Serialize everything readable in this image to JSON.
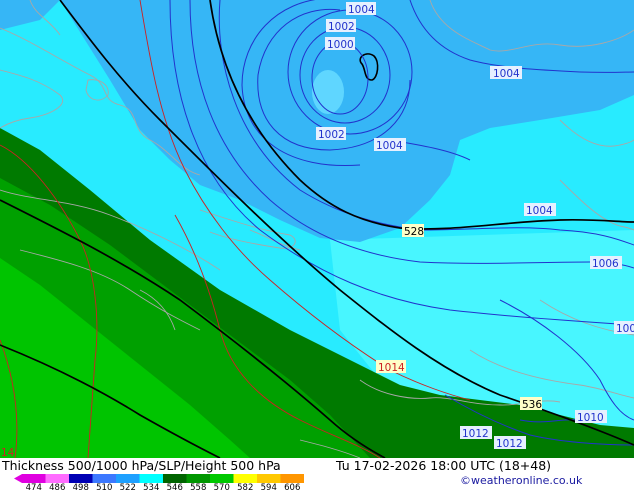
{
  "footer": {
    "title": "Thickness 500/1000 hPa/SLP/Height 500 hPa",
    "datetime": "Tu 17-02-2026 18:00 UTC (18+48)",
    "credit": "©weatheronline.co.uk"
  },
  "legend": {
    "ticks": [
      "474",
      "486",
      "498",
      "510",
      "522",
      "534",
      "546",
      "558",
      "570",
      "582",
      "594",
      "606"
    ],
    "colors": [
      "#e000e0",
      "#ff6cff",
      "#0000b4",
      "#3c78ff",
      "#1ea0ff",
      "#00ffff",
      "#006400",
      "#009600",
      "#00c800",
      "#ffff00",
      "#ffc800",
      "#ff9600"
    ]
  },
  "labels": {
    "slp": [
      {
        "text": "1004",
        "name": "isobar-label-1004-a"
      },
      {
        "text": "1002",
        "name": "isobar-label-1002-a"
      },
      {
        "text": "1000",
        "name": "isobar-label-1000"
      },
      {
        "text": "1004",
        "name": "isobar-label-1004-b"
      },
      {
        "text": "1002",
        "name": "isobar-label-1002-b"
      },
      {
        "text": "1004",
        "name": "isobar-label-1004-c"
      },
      {
        "text": "1004",
        "name": "isobar-label-1004-d"
      },
      {
        "text": "1006",
        "name": "isobar-label-1006"
      },
      {
        "text": "100",
        "name": "isobar-label-100-edge"
      },
      {
        "text": "1010",
        "name": "isobar-label-1010"
      },
      {
        "text": "1012",
        "name": "isobar-label-1012-a"
      },
      {
        "text": "1012",
        "name": "isobar-label-1012-b"
      }
    ],
    "height": [
      {
        "text": "528",
        "name": "height-label-528"
      },
      {
        "text": "536",
        "name": "height-label-536"
      }
    ],
    "pressure_red": [
      {
        "text": "1014",
        "name": "isobar-label-1014"
      },
      {
        "text": "14",
        "name": "isobar-label-14-edge"
      }
    ]
  },
  "colors": {
    "deep_blue_zone": "#36b6f6",
    "cyan_zone": "#28ebff",
    "light_cyan_zone": "#48f6ff",
    "dark_green_zone": "#007a00",
    "mid_green_zone": "#00a000",
    "light_green_zone": "#00c400",
    "isobar_blue": "#2233cc",
    "isobar_red": "#cc2222",
    "height_line": "#000000",
    "coast": "#a0a0a0"
  }
}
